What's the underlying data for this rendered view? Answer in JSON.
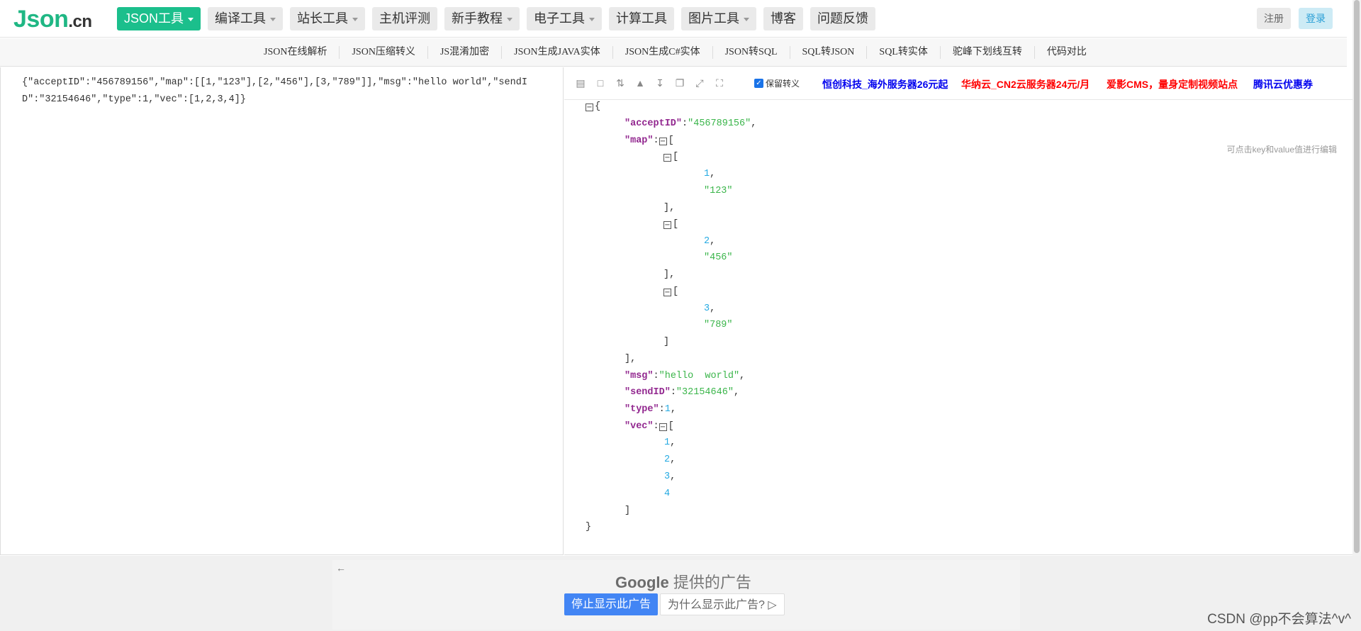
{
  "logo": {
    "main": "Json",
    "suffix": ".cn"
  },
  "nav": [
    {
      "label": "JSON工具",
      "dropdown": true,
      "active": true
    },
    {
      "label": "编译工具",
      "dropdown": true
    },
    {
      "label": "站长工具",
      "dropdown": true
    },
    {
      "label": "主机评测",
      "dropdown": false
    },
    {
      "label": "新手教程",
      "dropdown": true
    },
    {
      "label": "电子工具",
      "dropdown": true
    },
    {
      "label": "计算工具",
      "dropdown": false
    },
    {
      "label": "图片工具",
      "dropdown": true
    },
    {
      "label": "博客",
      "dropdown": false
    },
    {
      "label": "问题反馈",
      "dropdown": false
    }
  ],
  "auth": {
    "register": "注册",
    "login": "登录"
  },
  "subnav": [
    "JSON在线解析",
    "JSON压缩转义",
    "JS混淆加密",
    "JSON生成JAVA实体",
    "JSON生成C#实体",
    "JSON转SQL",
    "SQL转JSON",
    "SQL转实体",
    "驼峰下划线互转",
    "代码对比"
  ],
  "editor": {
    "raw_json": "{\"acceptID\":\"456789156\",\"map\":[[1,\"123\"],[2,\"456\"],[3,\"789\"]],\"msg\":\"hello world\",\"sendID\":\"32154646\",\"type\":1,\"vec\":[1,2,3,4]}"
  },
  "toolbar": {
    "icons": [
      "database-icon",
      "file-icon",
      "sort-icon",
      "trash-icon",
      "download-icon",
      "copy-icon",
      "compress-icon",
      "expand-icon"
    ],
    "keep_escape_label": "保留转义",
    "keep_escape_checked": true
  },
  "ads": [
    {
      "text": "恒创科技_海外服务器26元起",
      "color": "#0000ee"
    },
    {
      "text": "华纳云_CN2云服务器24元/月",
      "color": "#ff0000"
    },
    {
      "text": "爱影CMS，量身定制视频站点",
      "color": "#ff0000"
    },
    {
      "text": "腾讯云优惠券",
      "color": "#0000ee"
    }
  ],
  "viewer_hint": "可点击key和value值进行编辑",
  "tree": {
    "acceptID": "\"456789156\"",
    "map": [
      [
        "1",
        "\"123\""
      ],
      [
        "2",
        "\"456\""
      ],
      [
        "3",
        "\"789\""
      ]
    ],
    "msg": "\"hello  world\"",
    "sendID": "\"32154646\"",
    "type": "1",
    "vec": [
      "1",
      "2",
      "3",
      "4"
    ]
  },
  "google_ad": {
    "brand": "Google",
    "provided": "提供的广告",
    "stop_label": "停止显示此广告",
    "why_label": "为什么显示此广告?"
  },
  "watermark": "CSDN @pp不会算法^v^"
}
